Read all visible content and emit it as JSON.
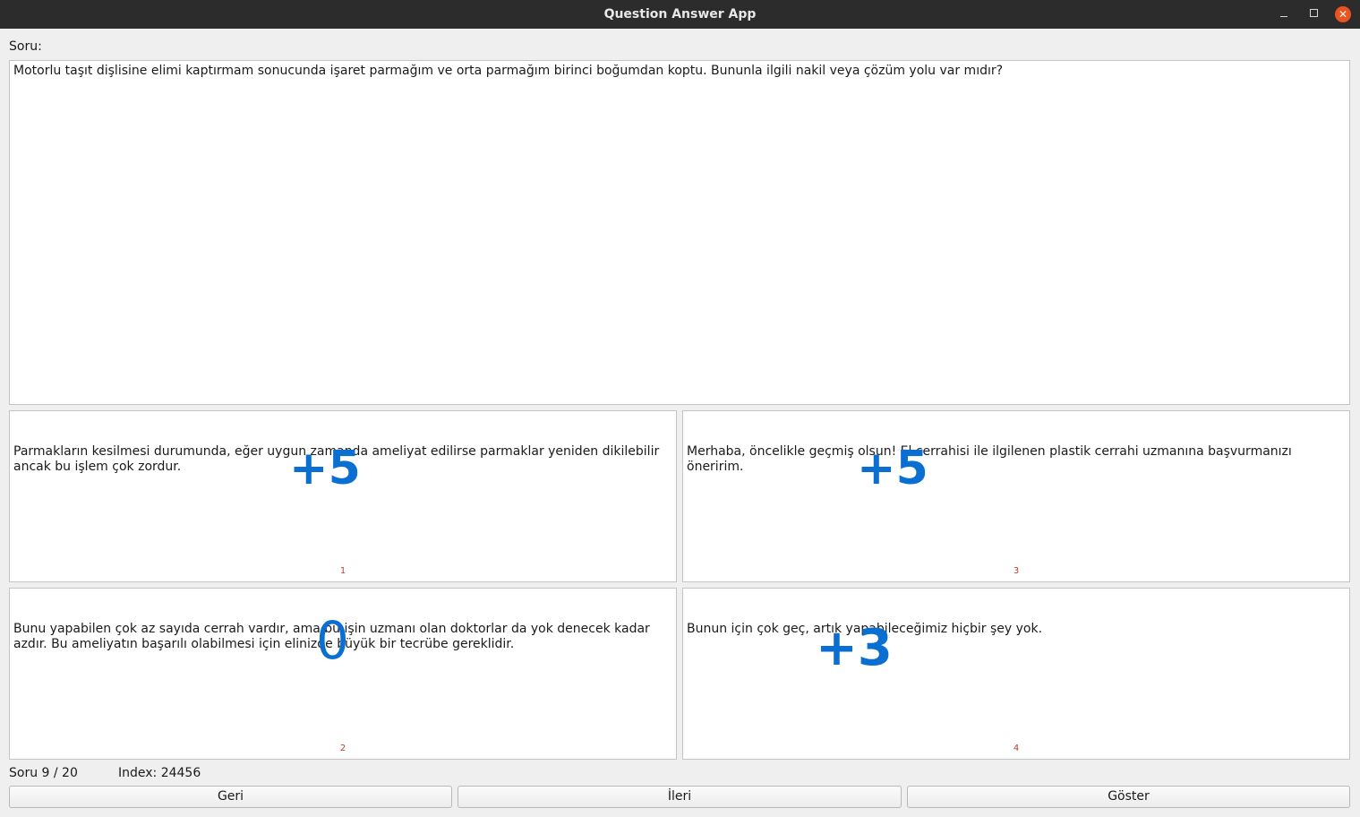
{
  "window": {
    "title": "Question Answer App"
  },
  "question": {
    "label": "Soru:",
    "text": "Motorlu taşıt dişlisine elimi kaptırmam sonucunda işaret parmağım ve orta parmağım birinci boğumdan koptu. Bununla ilgili nakil veya çözüm yolu var mıdır?"
  },
  "answers": [
    {
      "text": "Parmakların kesilmesi durumunda, eğer uygun zamanda ameliyat edilirse parmaklar yeniden dikilebilir ancak bu işlem çok zordur.",
      "score": "+5",
      "number": "1"
    },
    {
      "text": "Merhaba, öncelikle geçmiş olsun! El cerrahisi ile ilgilenen plastik cerrahi uzmanına başvurmanızı öneririm.",
      "score": "+5",
      "number": "3"
    },
    {
      "text": "Bunu yapabilen çok az sayıda cerrah vardır, ama bu işin uzmanı olan doktorlar da yok denecek kadar azdır. Bu ameliyatın başarılı olabilmesi için elinizde büyük bir tecrübe gereklidir.",
      "score": "0",
      "number": "2"
    },
    {
      "text": "Bunun için çok geç, artık yapabileceğimiz hiçbir şey yok.",
      "score": "+3",
      "number": "4"
    }
  ],
  "status": {
    "progress": "Soru 9 / 20",
    "index": "Index: 24456"
  },
  "buttons": {
    "back": "Geri",
    "next": "İleri",
    "show": "Göster"
  },
  "colors": {
    "titlebar": "#2c2c2c",
    "close": "#e95420",
    "score_ink": "#0a6fd1",
    "number": "#c0392b"
  }
}
